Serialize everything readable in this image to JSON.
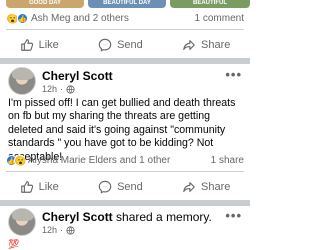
{
  "memory_strip": {
    "cards": [
      "GOOD DAY",
      "BEAUTIFUL DAY",
      "BEAUTIFUL"
    ]
  },
  "post1_footer": {
    "reactions_text": "Ash Meg and 2 others",
    "comments": "1 comment",
    "actions": {
      "like": "Like",
      "send": "Send",
      "share": "Share"
    }
  },
  "post2": {
    "author": "Cheryl Scott",
    "time": "12h",
    "body": "I'm pissed off! I can get bullied and death threats on fb but my sharing  the threats are getting deleted and said it's going against \"community standards \" you have got to be kidding? Not acceptable!",
    "reactions_text": "Alysha Marie Elders and 1 other",
    "shares": "1 share",
    "actions": {
      "like": "Like",
      "send": "Send",
      "share": "Share"
    }
  },
  "post3": {
    "author": "Cheryl Scott",
    "shared_text": "shared a memory.",
    "time": "12h",
    "emoji": "💯"
  },
  "colors": {
    "like_blue": "#1877f2",
    "wow_yellow": "#f7b125",
    "muted": "#65676b",
    "separator": "#c9ccd1"
  }
}
